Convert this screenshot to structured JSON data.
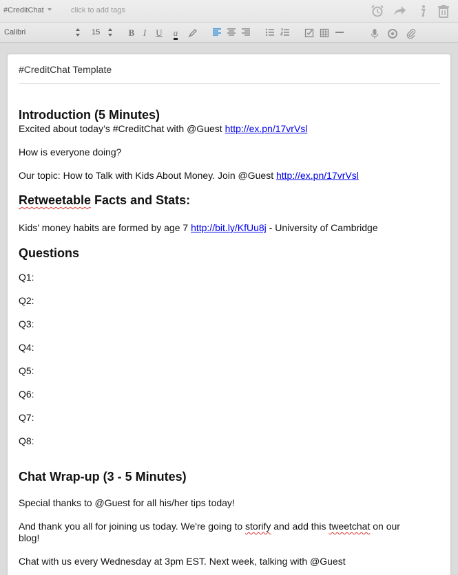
{
  "tagbar": {
    "notebook": "#CreditChat",
    "tags_placeholder": "click to add tags"
  },
  "toolbar": {
    "font": "Calibri",
    "size": "15"
  },
  "note": {
    "title": "#CreditChat Template",
    "intro_heading": "Introduction (5 Minutes)",
    "intro_line1_text": "Excited about today’s #CreditChat  with @Guest ",
    "intro_line1_link": "http://ex.pn/17vrVsl",
    "intro_line2": "How is everyone doing?",
    "intro_line3_text": "Our topic: How to Talk with Kids About Money.  Join @Guest ",
    "intro_line3_link": "http://ex.pn/17vrVsl",
    "facts_heading_word": "Retweetable",
    "facts_heading_rest": " Facts and Stats:",
    "fact1_text": "Kids’ money habits are formed by age 7 ",
    "fact1_link": "http://bit.ly/KfUu8j",
    "fact1_source": " -  University of Cambridge",
    "questions_heading": "Questions",
    "questions": [
      "Q1:",
      "Q2:",
      "Q3:",
      "Q4:",
      "Q5:",
      "Q6:",
      "Q7:",
      "Q8:"
    ],
    "wrap_heading": "Chat Wrap-up (3 - 5 Minutes)",
    "wrap_line1": "Special thanks to @Guest for all his/her tips today!",
    "wrap_line2_a": "And thank you all for joining us today. We're going to ",
    "wrap_line2_storify": "storify",
    "wrap_line2_b": " and add this ",
    "wrap_line2_tweetchat": "tweetchat",
    "wrap_line2_c": " on our",
    "wrap_line2_d": "blog!",
    "wrap_line3": "Chat with us every Wednesday at 3pm EST. Next week, talking with @Guest"
  },
  "colors": {
    "link": "#0000ee",
    "accent": "#2a8ad8",
    "spellcheck": "#e03030"
  }
}
